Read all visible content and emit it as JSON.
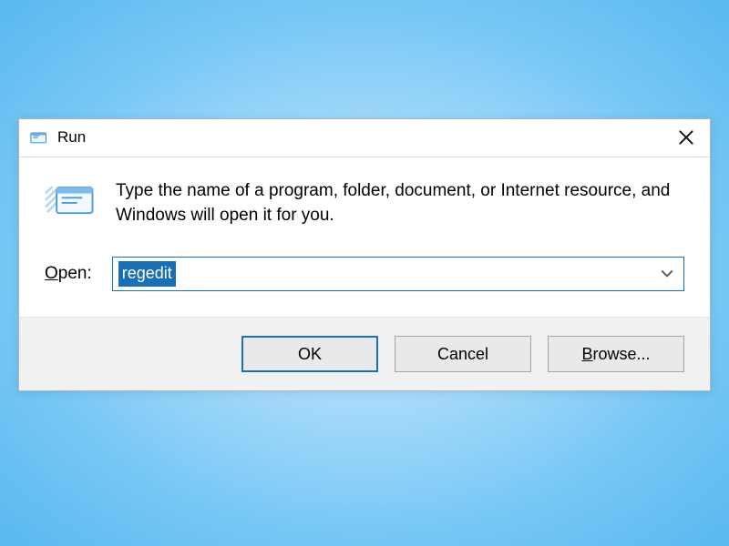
{
  "titlebar": {
    "title": "Run",
    "close_label": "✕"
  },
  "body": {
    "description": "Type the name of a program, folder, document, or Internet resource, and Windows will open it for you.",
    "open_label_pre": "",
    "open_label_accel": "O",
    "open_label_post": "pen:",
    "command_value": "regedit"
  },
  "buttons": {
    "ok": "OK",
    "cancel": "Cancel",
    "browse_accel": "B",
    "browse_rest": "rowse..."
  },
  "icons": {
    "run": "run-icon",
    "chevron": "▾"
  }
}
